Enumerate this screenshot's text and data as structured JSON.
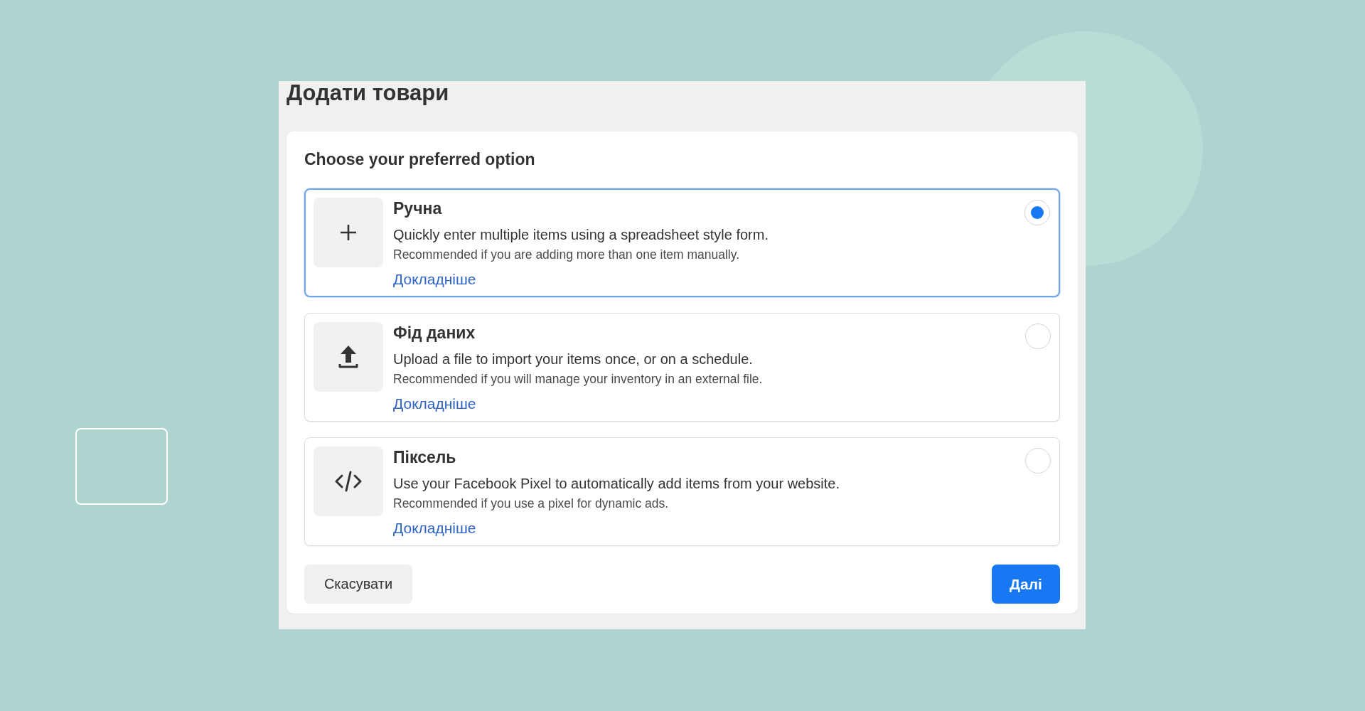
{
  "dialog": {
    "title": "Додати товари",
    "heading": "Choose your preferred option",
    "options": [
      {
        "kind": "manual",
        "title": "Ручна",
        "description": "Quickly enter multiple items using a spreadsheet style form.",
        "note": "Recommended if you are adding more than one item manually.",
        "link": "Докладніше",
        "selected": true
      },
      {
        "kind": "feed",
        "title": "Фід даних",
        "description": "Upload a file to import your items once, or on a schedule.",
        "note": "Recommended if you will manage your inventory in an external file.",
        "link": "Докладніше",
        "selected": false
      },
      {
        "kind": "pixel",
        "title": "Піксель",
        "description": "Use your Facebook Pixel to automatically add items from your website.",
        "note": "Recommended if you use a pixel for dynamic ads.",
        "link": "Докладніше",
        "selected": false
      }
    ],
    "cancel_button": "Скасувати",
    "next_button": "Далі"
  }
}
